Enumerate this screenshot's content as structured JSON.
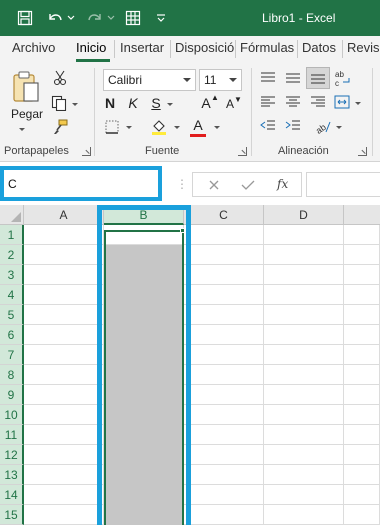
{
  "titlebar": {
    "title": "Libro1  -  Excel",
    "accent": "#217346",
    "icons": [
      "save-icon",
      "undo-icon",
      "redo-icon",
      "table-icon",
      "customize-qat-icon"
    ]
  },
  "ribbon_tabs": [
    "Archivo",
    "Inicio",
    "Insertar",
    "Disposició",
    "Fórmulas",
    "Datos",
    "Revisa"
  ],
  "active_tab": "Inicio",
  "ribbon": {
    "portapapeles": {
      "label": "Portapapeles",
      "paste_label": "Pegar"
    },
    "fuente": {
      "label": "Fuente",
      "font_name": "Calibri",
      "font_size": "11",
      "bold": "N",
      "italic": "K",
      "underline": "S",
      "grow_font": "A",
      "shrink_font": "A",
      "font_color_letter": "A"
    },
    "alineacion": {
      "label": "Alineación"
    }
  },
  "formula_bar": {
    "name_box_value": "C",
    "fx_label": "fx",
    "formula_value": ""
  },
  "sheet": {
    "columns": [
      "A",
      "B",
      "C",
      "D"
    ],
    "rows": [
      "1",
      "2",
      "3",
      "4",
      "5",
      "6",
      "7",
      "8",
      "9",
      "10",
      "11",
      "12",
      "13",
      "14",
      "15"
    ],
    "selected_column": "B",
    "active_cell": "B1"
  },
  "colors": {
    "excel_green": "#217346",
    "highlight_blue": "#1aa0dc",
    "selection_fill": "#c6c6c6"
  }
}
